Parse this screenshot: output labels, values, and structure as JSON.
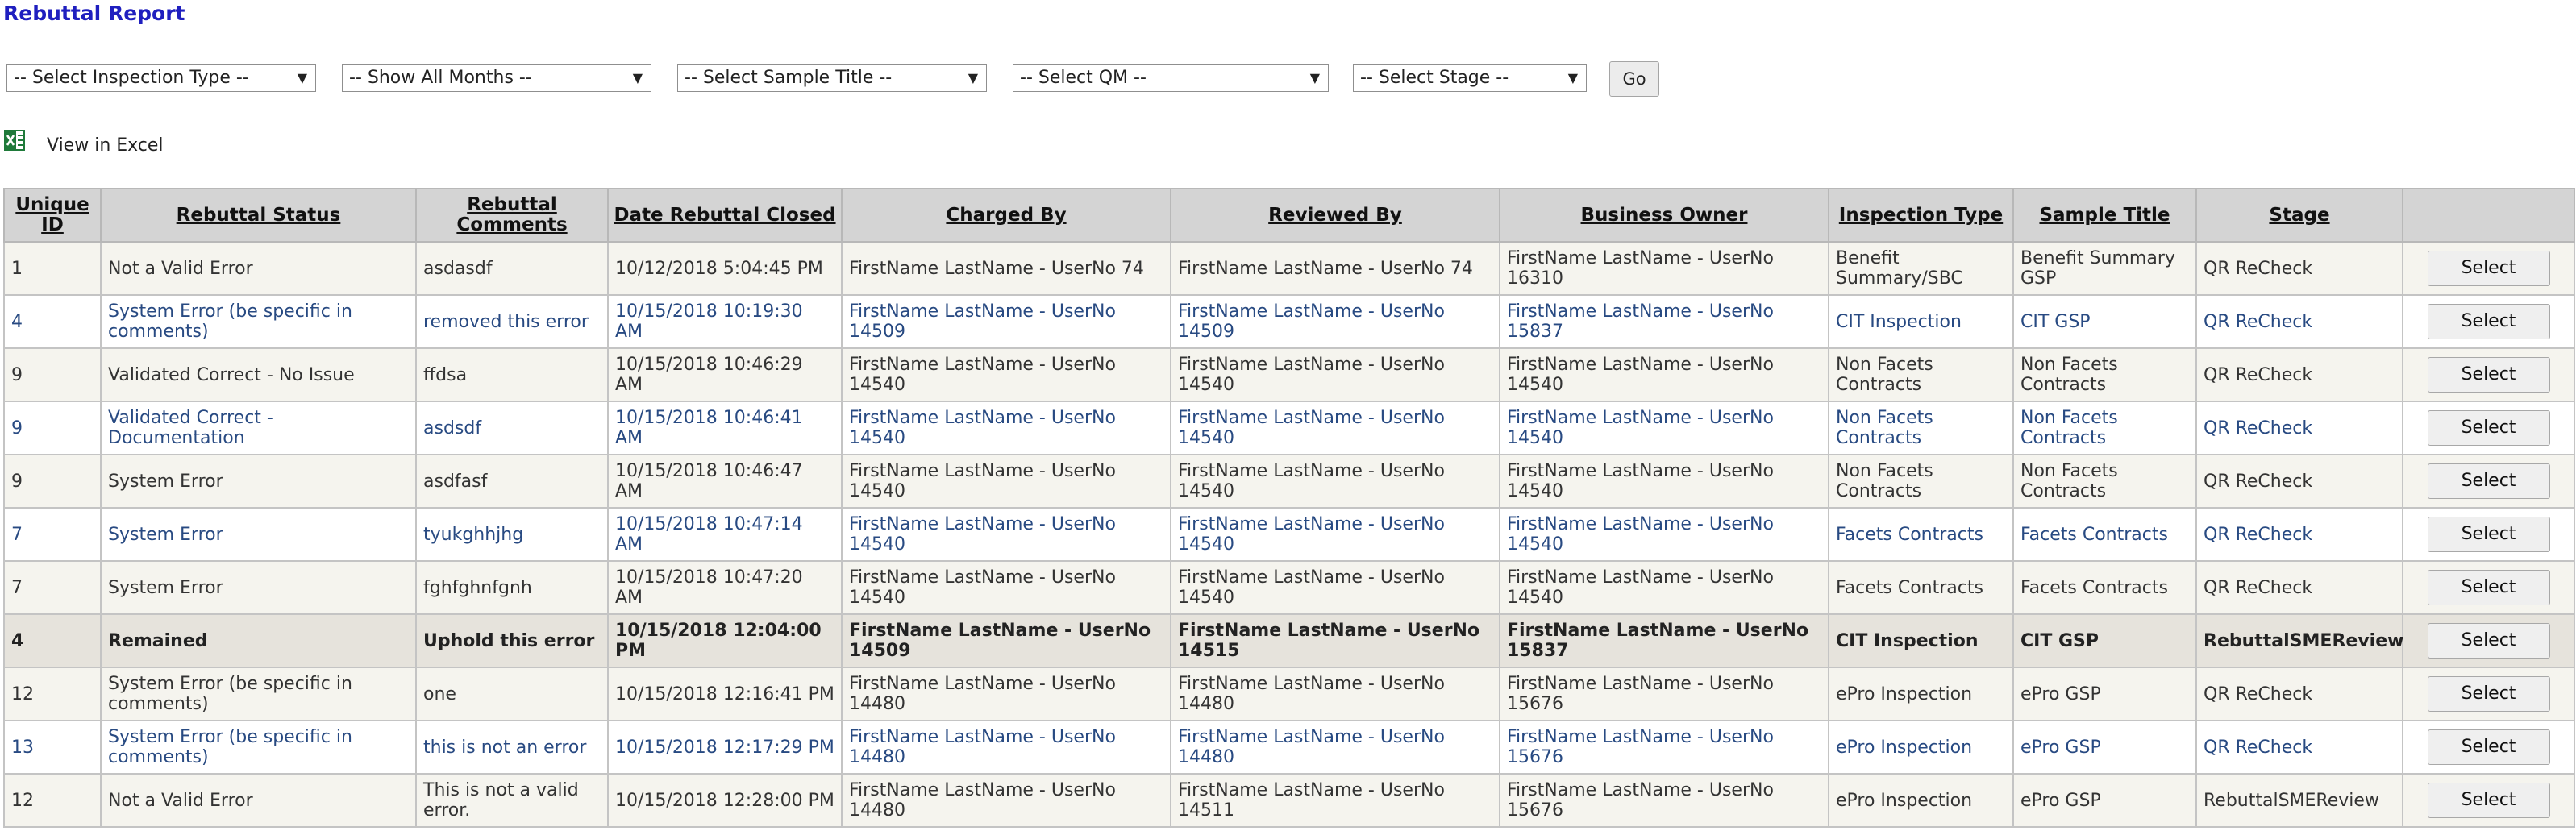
{
  "page": {
    "title": "Rebuttal Report"
  },
  "filters": {
    "inspection_type": "-- Select Inspection Type --",
    "months": "-- Show All Months --",
    "sample_title": "-- Select Sample Title --",
    "qm": "-- Select QM --",
    "stage": "-- Select Stage --",
    "go_label": "Go"
  },
  "excel": {
    "label": "View in Excel"
  },
  "table": {
    "columns": [
      "Unique ID",
      "Rebuttal Status",
      "Rebuttal Comments",
      "Date Rebuttal Closed",
      "Charged By",
      "Reviewed By",
      "Business Owner",
      "Inspection Type",
      "Sample Title",
      "Stage",
      ""
    ],
    "select_label": "Select",
    "rows": [
      {
        "id": "1",
        "status": "Not a Valid Error",
        "comments": "asdasdf",
        "date": "10/12/2018 5:04:45 PM",
        "charged": "FirstName LastName - UserNo 74",
        "reviewed": "FirstName LastName - UserNo 74",
        "owner": "FirstName LastName - UserNo 16310",
        "type": "Benefit Summary/SBC",
        "sample": "Benefit Summary GSP",
        "stage": "QR ReCheck"
      },
      {
        "id": "4",
        "status": "System Error (be specific in comments)",
        "comments": "removed this error",
        "date": "10/15/2018 10:19:30 AM",
        "charged": "FirstName LastName - UserNo 14509",
        "reviewed": "FirstName LastName - UserNo 14509",
        "owner": "FirstName LastName - UserNo 15837",
        "type": "CIT Inspection",
        "sample": "CIT GSP",
        "stage": "QR ReCheck"
      },
      {
        "id": "9",
        "status": "Validated Correct - No Issue",
        "comments": "ffdsa",
        "date": "10/15/2018 10:46:29 AM",
        "charged": "FirstName LastName - UserNo 14540",
        "reviewed": "FirstName LastName - UserNo 14540",
        "owner": "FirstName LastName - UserNo 14540",
        "type": "Non Facets Contracts",
        "sample": "Non Facets Contracts",
        "stage": "QR ReCheck"
      },
      {
        "id": "9",
        "status": "Validated Correct - Documentation",
        "comments": "asdsdf",
        "date": "10/15/2018 10:46:41 AM",
        "charged": "FirstName LastName - UserNo 14540",
        "reviewed": "FirstName LastName - UserNo 14540",
        "owner": "FirstName LastName - UserNo 14540",
        "type": "Non Facets Contracts",
        "sample": "Non Facets Contracts",
        "stage": "QR ReCheck"
      },
      {
        "id": "9",
        "status": "System Error",
        "comments": "asdfasf",
        "date": "10/15/2018 10:46:47 AM",
        "charged": "FirstName LastName - UserNo 14540",
        "reviewed": "FirstName LastName - UserNo 14540",
        "owner": "FirstName LastName - UserNo 14540",
        "type": "Non Facets Contracts",
        "sample": "Non Facets Contracts",
        "stage": "QR ReCheck"
      },
      {
        "id": "7",
        "status": "System Error",
        "comments": "tyukghhjhg",
        "date": "10/15/2018 10:47:14 AM",
        "charged": "FirstName LastName - UserNo 14540",
        "reviewed": "FirstName LastName - UserNo 14540",
        "owner": "FirstName LastName - UserNo 14540",
        "type": "Facets Contracts",
        "sample": "Facets Contracts",
        "stage": "QR ReCheck"
      },
      {
        "id": "7",
        "status": "System Error",
        "comments": "fghfghnfgnh",
        "date": "10/15/2018 10:47:20 AM",
        "charged": "FirstName LastName - UserNo 14540",
        "reviewed": "FirstName LastName - UserNo 14540",
        "owner": "FirstName LastName - UserNo 14540",
        "type": "Facets Contracts",
        "sample": "Facets Contracts",
        "stage": "QR ReCheck"
      },
      {
        "id": "4",
        "status": "Remained",
        "comments": "Uphold this error",
        "date": "10/15/2018 12:04:00 PM",
        "charged": "FirstName LastName - UserNo 14509",
        "reviewed": "FirstName LastName - UserNo 14515",
        "owner": "FirstName LastName - UserNo 15837",
        "type": "CIT Inspection",
        "sample": "CIT GSP",
        "stage": "RebuttalSMEReview"
      },
      {
        "id": "12",
        "status": "System Error (be specific in comments)",
        "comments": "one",
        "date": "10/15/2018 12:16:41 PM",
        "charged": "FirstName LastName - UserNo 14480",
        "reviewed": "FirstName LastName - UserNo 14480",
        "owner": "FirstName LastName - UserNo 15676",
        "type": "ePro Inspection",
        "sample": "ePro GSP",
        "stage": "QR ReCheck"
      },
      {
        "id": "13",
        "status": "System Error (be specific in comments)",
        "comments": "this is not an error",
        "date": "10/15/2018 12:17:29 PM",
        "charged": "FirstName LastName - UserNo 14480",
        "reviewed": "FirstName LastName - UserNo 14480",
        "owner": "FirstName LastName - UserNo 15676",
        "type": "ePro Inspection",
        "sample": "ePro GSP",
        "stage": "QR ReCheck"
      },
      {
        "id": "12",
        "status": "Not a Valid Error",
        "comments": "This is not a valid error.",
        "date": "10/15/2018 12:28:00 PM",
        "charged": "FirstName LastName - UserNo 14480",
        "reviewed": "FirstName LastName - UserNo 14511",
        "owner": "FirstName LastName - UserNo 15676",
        "type": "ePro Inspection",
        "sample": "ePro GSP",
        "stage": "RebuttalSMEReview"
      }
    ],
    "highlighted_row_index": 7
  },
  "colors": {
    "title": "#1f1fbf",
    "link_text": "#284a82",
    "header_bg": "#d4d4d4",
    "excel_green": "#1f7a3a"
  }
}
